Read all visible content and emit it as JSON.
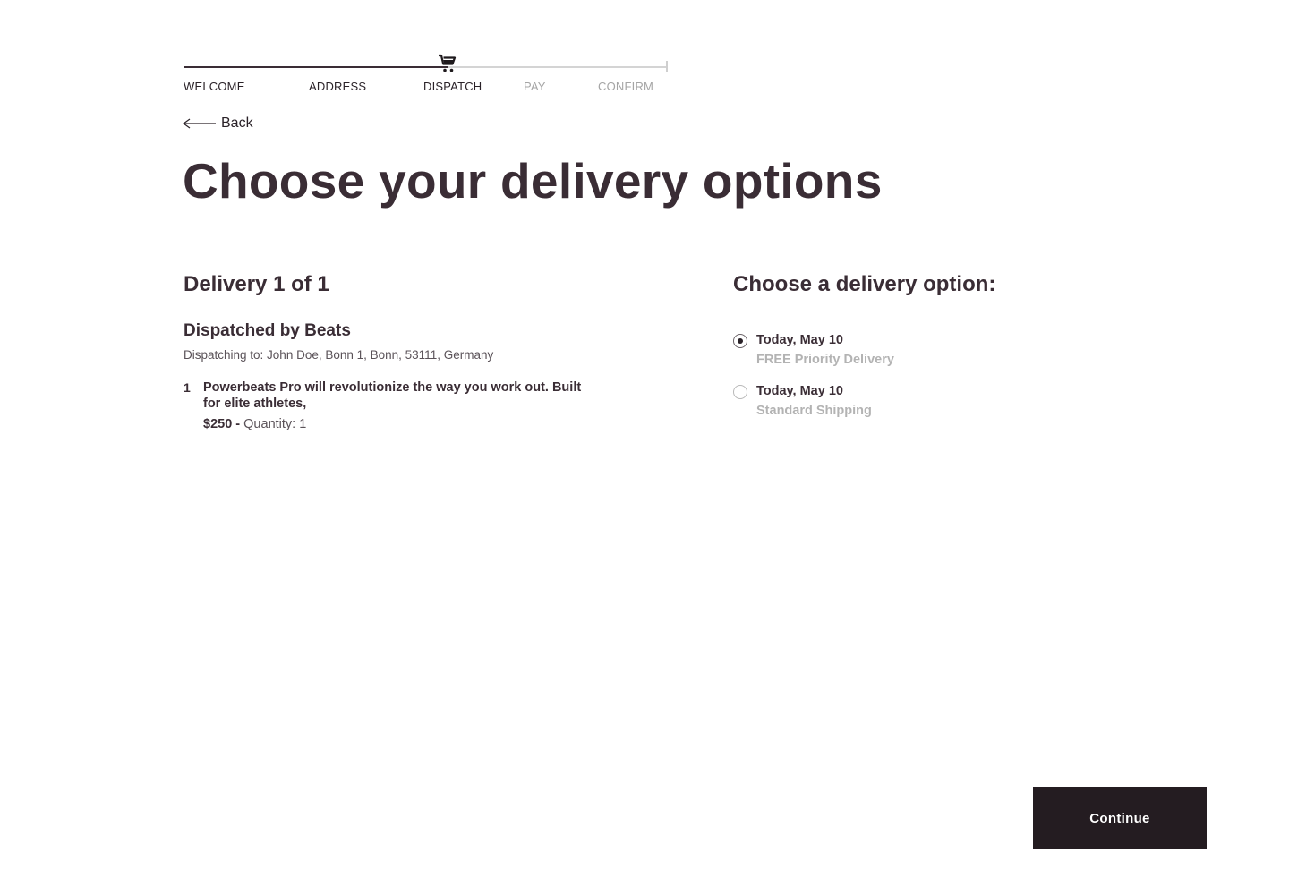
{
  "stepper": {
    "steps": [
      {
        "label": "WELCOME",
        "state": "done"
      },
      {
        "label": "ADDRESS",
        "state": "done"
      },
      {
        "label": "DISPATCH",
        "state": "current"
      },
      {
        "label": "PAY",
        "state": "todo"
      },
      {
        "label": "CONFIRM",
        "state": "todo"
      }
    ],
    "current_icon": "cart-icon"
  },
  "back": {
    "label": "Back",
    "icon": "arrow-left-icon"
  },
  "page_title": "Choose your delivery options",
  "delivery": {
    "count_label": "Delivery 1 of 1",
    "dispatched_by": "Dispatched by Beats",
    "dispatching_to": "Dispatching to: John Doe, Bonn 1, Bonn, 53111, Germany",
    "items": [
      {
        "index": "1",
        "name": "Powerbeats Pro will revolutionize the way you work out. Built for elite athletes,",
        "price": "$250 -",
        "quantity": "Quantity: 1"
      }
    ]
  },
  "options": {
    "heading": "Choose a delivery option:",
    "choices": [
      {
        "date": "Today, May 10",
        "description": "FREE Priority Delivery",
        "selected": true
      },
      {
        "date": "Today, May 10",
        "description": "Standard Shipping",
        "selected": false
      }
    ]
  },
  "actions": {
    "continue_label": "Continue"
  },
  "colors": {
    "primary_text": "#3a2d35",
    "muted_text": "#b3b3b3",
    "button_bg": "#241c21"
  }
}
